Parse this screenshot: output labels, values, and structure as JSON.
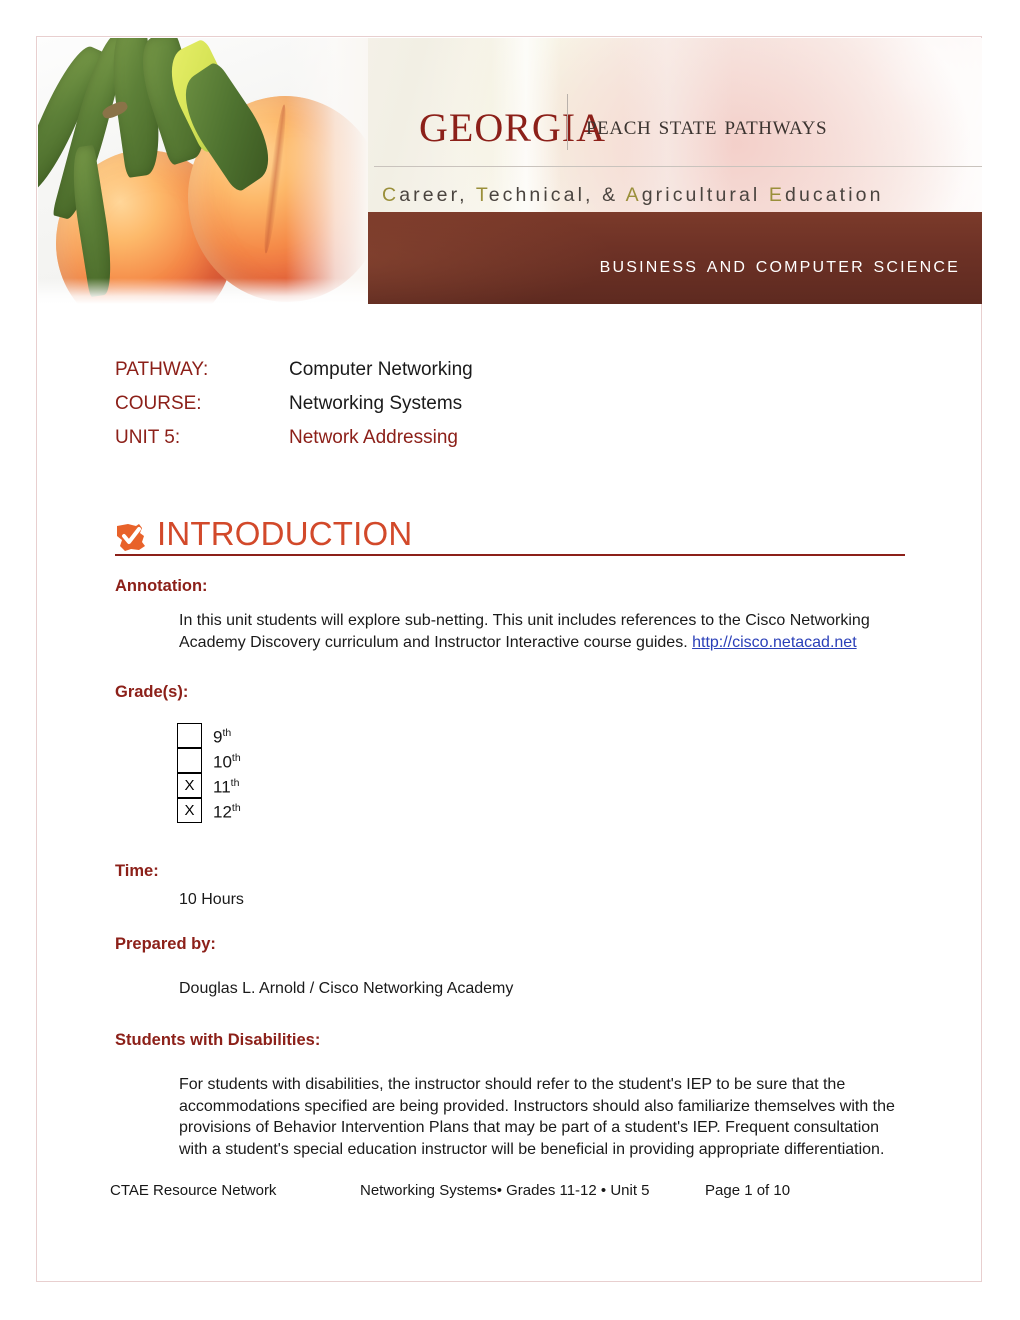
{
  "banner": {
    "state_name": "Georgia",
    "program_name": "Peach State Pathways",
    "tagline_parts": [
      {
        "text": "C",
        "highlight": true
      },
      {
        "text": "areer, ",
        "highlight": false
      },
      {
        "text": "T",
        "highlight": true
      },
      {
        "text": "echnical, & ",
        "highlight": false
      },
      {
        "text": "A",
        "highlight": true
      },
      {
        "text": "gricultural ",
        "highlight": false
      },
      {
        "text": "E",
        "highlight": true
      },
      {
        "text": "ducation",
        "highlight": false
      }
    ],
    "tagline_plain": "Career, Technical, & Agricultural Education",
    "subject_bar": "Business and Computer Science"
  },
  "meta": {
    "pathway_label": "PATHWAY:",
    "pathway_value": "Computer Networking",
    "course_label": "COURSE:",
    "course_value": "Networking Systems",
    "unit_label": "UNIT 5:",
    "unit_value": "Network Addressing"
  },
  "introduction": {
    "section_title": "INTRODUCTION",
    "annotation_label": "Annotation:",
    "annotation_text": "In this unit students will explore sub-netting. This unit includes references to the Cisco Networking Academy Discovery curriculum and Instructor Interactive course guides. ",
    "annotation_link": "http://cisco.netacad.net",
    "grades_label": "Grade(s):",
    "grades": [
      {
        "label": "9",
        "ordinal": "th",
        "checked": false,
        "mark": ""
      },
      {
        "label": "10",
        "ordinal": "th",
        "checked": false,
        "mark": ""
      },
      {
        "label": "11",
        "ordinal": "th",
        "checked": true,
        "mark": "X"
      },
      {
        "label": "12",
        "ordinal": "th",
        "checked": true,
        "mark": "X"
      }
    ],
    "time_label": "Time:",
    "time_value": "10 Hours",
    "prepared_by_label": "Prepared by:",
    "prepared_by_value": "Douglas L. Arnold / Cisco Networking Academy",
    "disabilities_label": "Students with Disabilities:",
    "disabilities_text": "For students with disabilities, the instructor should refer to the student's IEP to be sure that the accommodations specified are being provided. Instructors should also familiarize themselves with the provisions of Behavior Intervention Plans that may be part of a student's IEP. Frequent consultation with a student's special education instructor will be beneficial in providing appropriate differentiation."
  },
  "footer": {
    "left": "CTAE Resource Network",
    "center": "Networking Systems• Grades 11-12 • Unit 5",
    "right": "Page 1 of 10"
  },
  "colors": {
    "accent_red": "#8c2019",
    "heading_orange": "#d2492a",
    "bar_brown": "#6e3226",
    "link_blue": "#2a3fb8",
    "page_border": "#e8cfcf"
  }
}
